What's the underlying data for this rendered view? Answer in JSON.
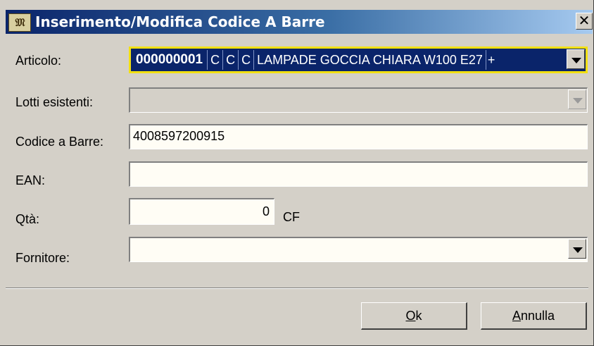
{
  "window": {
    "title": "Inserimento/Modifica Codice A Barre",
    "icon_text": "🕮",
    "close_label": "×"
  },
  "labels": {
    "articolo": "Articolo:",
    "lotti": "Lotti esistenti:",
    "codice": "Codice a Barre:",
    "ean": "EAN:",
    "qta": "Qtà:",
    "fornitore": "Fornitore:"
  },
  "articolo": {
    "code": "000000001",
    "c1": "C",
    "c2": "C",
    "c3": "C",
    "description": "LAMPADE GOCCIA CHIARA W100 E27",
    "overflow": "+"
  },
  "fields": {
    "lotti_value": "",
    "codice_value": "4008597200915",
    "ean_value": "",
    "qta_value": "0",
    "qta_unit": "CF",
    "fornitore_value": ""
  },
  "buttons": {
    "ok_mnemonic": "O",
    "ok_rest": "k",
    "cancel_mnemonic": "A",
    "cancel_rest": "nnulla"
  },
  "colors": {
    "title_start": "#0a246a",
    "title_end": "#a6caf0",
    "selection_bg": "#0a246a",
    "selection_border": "#f2e012",
    "face": "#d4d0c8"
  }
}
